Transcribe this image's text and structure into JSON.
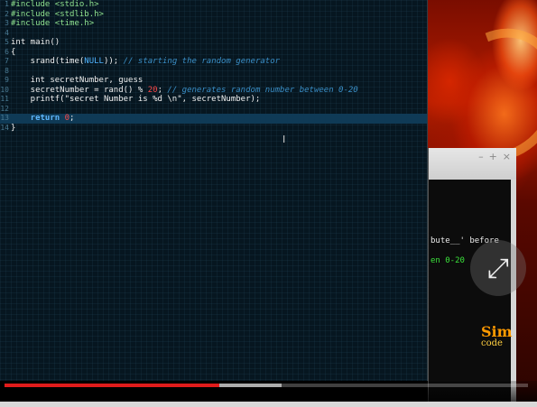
{
  "editor": {
    "lines": [
      {
        "num": "1",
        "tokens": [
          {
            "t": "#include",
            "c": "pp"
          },
          {
            "t": " <stdio.h>",
            "c": "pp"
          }
        ]
      },
      {
        "num": "2",
        "tokens": [
          {
            "t": "#include",
            "c": "pp"
          },
          {
            "t": " <stdlib.h>",
            "c": "pp"
          }
        ]
      },
      {
        "num": "3",
        "tokens": [
          {
            "t": "#include",
            "c": "pp"
          },
          {
            "t": " <time.h>",
            "c": "pp"
          }
        ]
      },
      {
        "num": "4",
        "tokens": []
      },
      {
        "num": "5",
        "tokens": [
          {
            "t": "int main()",
            "c": "kw"
          }
        ]
      },
      {
        "num": "6",
        "tokens": [
          {
            "t": "{",
            "c": "kw"
          }
        ]
      },
      {
        "num": "7",
        "tokens": [
          {
            "t": "    srand(time(",
            "c": "kw"
          },
          {
            "t": "NULL",
            "c": "const"
          },
          {
            "t": ")); ",
            "c": "kw"
          },
          {
            "t": "// starting the random generator",
            "c": "cm"
          }
        ]
      },
      {
        "num": "8",
        "tokens": []
      },
      {
        "num": "9",
        "tokens": [
          {
            "t": "    int secretNumber, guess",
            "c": "kw"
          }
        ]
      },
      {
        "num": "10",
        "tokens": [
          {
            "t": "    secretNumber = rand() % ",
            "c": "kw"
          },
          {
            "t": "20",
            "c": "num"
          },
          {
            "t": "; ",
            "c": "kw"
          },
          {
            "t": "// generates random number between 0-20",
            "c": "cm"
          }
        ]
      },
      {
        "num": "11",
        "tokens": [
          {
            "t": "    printf(\"secret Number is %d \\n\", secretNumber);",
            "c": "str"
          }
        ]
      },
      {
        "num": "12",
        "tokens": []
      },
      {
        "num": "13",
        "tokens": [
          {
            "t": "    return ",
            "c": "ret"
          },
          {
            "t": "0",
            "c": "num"
          },
          {
            "t": ";",
            "c": "kw"
          }
        ],
        "current": true
      },
      {
        "num": "14",
        "tokens": [
          {
            "t": "}",
            "c": "kw"
          }
        ]
      }
    ]
  },
  "terminal": {
    "buttons": [
      "–",
      "+",
      "×"
    ],
    "line1": "bute__' before",
    "line2": "en 0-20"
  },
  "overlay": {
    "pip_icon": "picture-in-picture-icon",
    "pip_glyph": "⤢",
    "logo_top": "Sim",
    "logo_bottom": "code"
  },
  "video": {
    "played_fraction": 0.41,
    "buffered_fraction": 0.53,
    "played_color": "#e01b1b"
  },
  "colors": {
    "editor_bg": "#061620",
    "current_line": "#0f3a56",
    "preprocessor": "#8fe28f",
    "comment": "#3a8ec6",
    "number": "#ff4a4a",
    "constant": "#4fb3ff"
  }
}
